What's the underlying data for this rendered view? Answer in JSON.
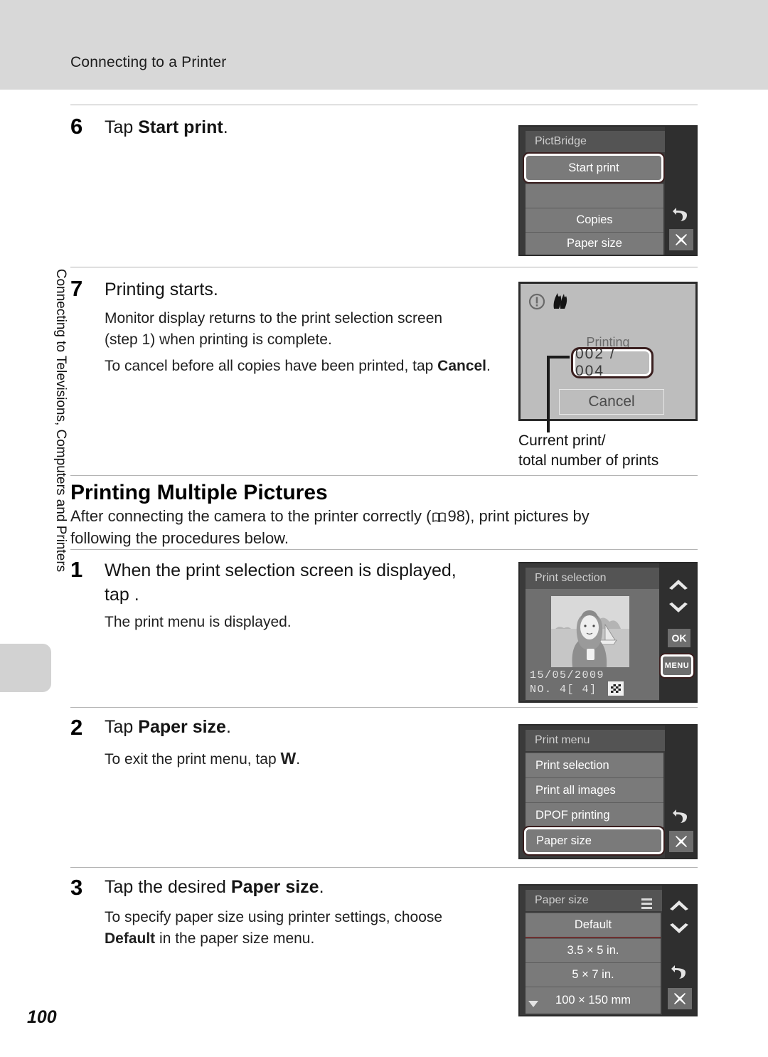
{
  "header": {
    "section_title": "Connecting to a Printer"
  },
  "sidebar": {
    "chapter_label": "Connecting to Televisions, Computers and Printers"
  },
  "footer": {
    "page_number": "100"
  },
  "steps": [
    {
      "number": "6",
      "title_prefix": "Tap ",
      "title_bold": "Start print",
      "title_suffix": "."
    },
    {
      "number": "7",
      "title": "Printing starts.",
      "body_line1": "Monitor display returns to the print selection screen",
      "body_line2": "(step 1) when printing is complete.",
      "body_line3_prefix": "To cancel before all copies have been printed, tap ",
      "body_line3_bold": "Cancel",
      "body_line3_suffix": "."
    },
    {
      "number": "1",
      "title_line1": "When the print selection screen is displayed,",
      "title_line2": "tap          .",
      "body": "The print menu is displayed."
    },
    {
      "number": "2",
      "title_prefix": "Tap ",
      "title_bold": "Paper size",
      "title_suffix": ".",
      "body_prefix": "To exit the print menu, tap ",
      "body_glyph": "W",
      "body_suffix": "."
    },
    {
      "number": "3",
      "title_prefix": "Tap the desired ",
      "title_bold": "Paper size",
      "title_suffix": ".",
      "body_line1": "To specify paper size using printer settings, choose",
      "body_line2_bold": "Default",
      "body_line2_rest": " in the paper size menu."
    }
  ],
  "section": {
    "heading": "Printing Multiple Pictures",
    "body_part1": "After connecting the camera to the printer correctly (",
    "body_ref": "98",
    "body_part2": "), print pictures by",
    "body_line2": "following the procedures below."
  },
  "callout": {
    "line1": "Current print/",
    "line2": "total number of prints"
  },
  "screens": {
    "pictbridge": {
      "title": "PictBridge",
      "items": [
        {
          "label": "Start print",
          "selected": true
        },
        {
          "label": "",
          "selected": false
        },
        {
          "label": "Copies",
          "selected": false
        },
        {
          "label": "Paper size",
          "selected": false
        }
      ],
      "side_icons": [
        "back-icon",
        "close-icon"
      ]
    },
    "printing": {
      "status_icons": [
        "warning-icon",
        "ink-icon"
      ],
      "label": "Printing",
      "counter": "002 / 004",
      "cancel_label": "Cancel"
    },
    "print_selection": {
      "title": "Print selection",
      "date": "15/05/2009",
      "number_line": "NO.    4[     4]",
      "side_icons": [
        "chevron-up-icon",
        "chevron-down-icon",
        "ok-icon",
        "menu-icon"
      ],
      "menu_button_label": "MENU",
      "ok_button_label": "OK"
    },
    "print_menu": {
      "title": "Print menu",
      "items": [
        {
          "label": "Print selection",
          "selected": false
        },
        {
          "label": "Print all images",
          "selected": false
        },
        {
          "label": "DPOF printing",
          "selected": false
        },
        {
          "label": "Paper size",
          "selected": true
        }
      ],
      "side_icons": [
        "back-icon",
        "close-icon"
      ]
    },
    "paper_size": {
      "title": "Paper size",
      "items": [
        {
          "label": "Default",
          "selected": false
        },
        {
          "label": "3.5 × 5 in.",
          "selected": false
        },
        {
          "label": "5 × 7 in.",
          "selected": false
        },
        {
          "label": "100 × 150 mm",
          "selected": false
        }
      ],
      "side_icons": [
        "chevron-up-icon",
        "chevron-down-icon",
        "back-icon",
        "close-icon"
      ],
      "has_more_indicator": true
    }
  },
  "colors": {
    "header_band": "#d8d8d8",
    "screen_dark": "#2f2f2f",
    "screen_row": "#7a7a7a",
    "screen_titlebar": "#545454",
    "highlight_outline": "#ffffff"
  }
}
